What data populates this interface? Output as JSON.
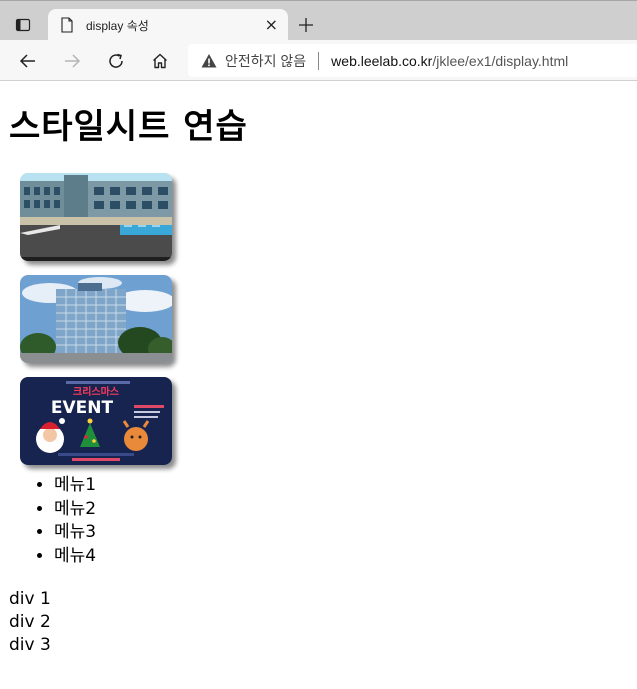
{
  "browser": {
    "tab_title": "display 속성",
    "tab_close": "×",
    "address": {
      "security_label": "안전하지 않음",
      "url_host": "web.leelab.co.kr",
      "url_path": "/jklee/ex1/display.html"
    }
  },
  "page": {
    "heading": "스타일시트 연습",
    "poster": {
      "line1": "크리스마스",
      "line2": "EVENT"
    },
    "menu": [
      "메뉴1",
      "메뉴2",
      "메뉴3",
      "메뉴4"
    ],
    "divs": [
      "div 1",
      "div 2",
      "div 3"
    ]
  }
}
